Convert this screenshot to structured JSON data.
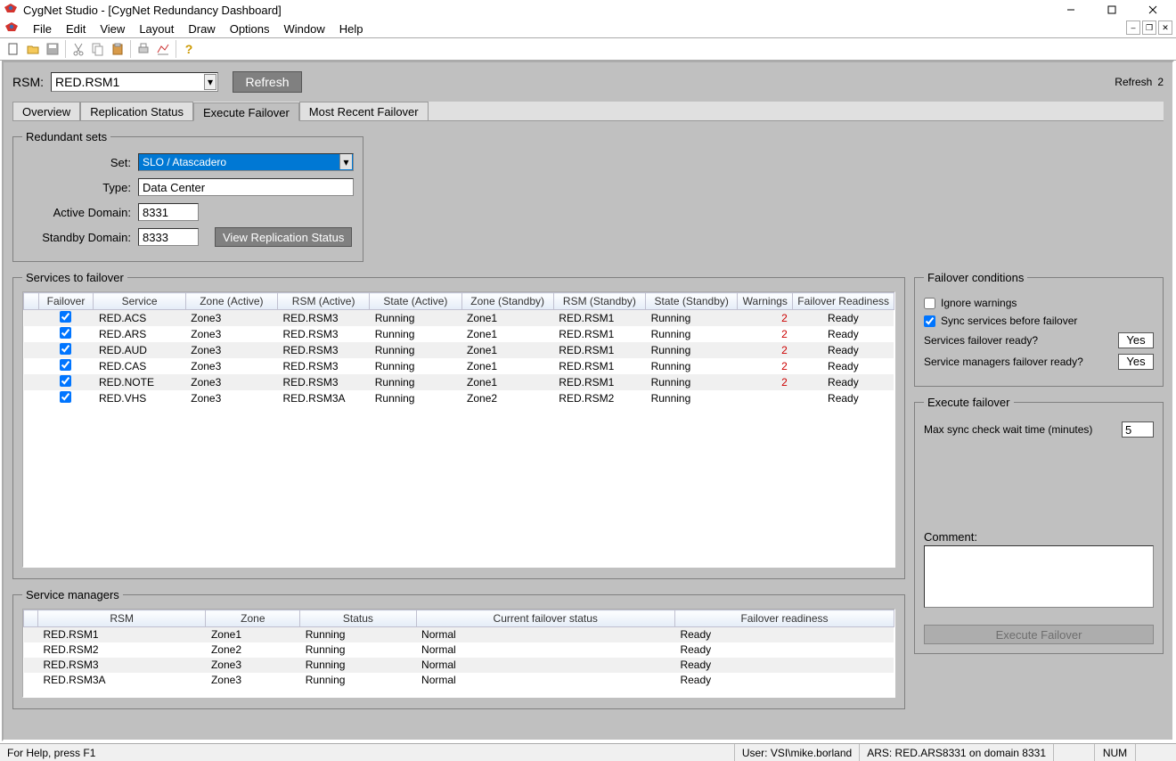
{
  "window_title": "CygNet Studio - [CygNet Redundancy Dashboard]",
  "menu": [
    "File",
    "Edit",
    "View",
    "Layout",
    "Draw",
    "Options",
    "Window",
    "Help"
  ],
  "rsm_label": "RSM:",
  "rsm_value": "RED.RSM1",
  "refresh_btn": "Refresh",
  "refresh_lbl": "Refresh",
  "refresh_count": "2",
  "tabs": [
    "Overview",
    "Replication Status",
    "Execute Failover",
    "Most Recent Failover"
  ],
  "active_tab": 2,
  "redundant_sets": {
    "legend": "Redundant sets",
    "set_label": "Set:",
    "set_value": "SLO / Atascadero",
    "type_label": "Type:",
    "type_value": "Data Center",
    "active_domain_label": "Active Domain:",
    "active_domain_value": "8331",
    "standby_domain_label": "Standby Domain:",
    "standby_domain_value": "8333",
    "view_repl_btn": "View Replication Status"
  },
  "services_legend": "Services to failover",
  "services_cols": [
    "Failover",
    "Service",
    "Zone (Active)",
    "RSM (Active)",
    "State (Active)",
    "Zone (Standby)",
    "RSM (Standby)",
    "State (Standby)",
    "Warnings",
    "Failover Readiness"
  ],
  "services_rows": [
    {
      "chk": true,
      "svc": "RED.ACS",
      "za": "Zone3",
      "ra": "RED.RSM3",
      "sa": "Running",
      "zs": "Zone1",
      "rs": "RED.RSM1",
      "ss": "Running",
      "w": "2",
      "fr": "Ready"
    },
    {
      "chk": true,
      "svc": "RED.ARS",
      "za": "Zone3",
      "ra": "RED.RSM3",
      "sa": "Running",
      "zs": "Zone1",
      "rs": "RED.RSM1",
      "ss": "Running",
      "w": "2",
      "fr": "Ready"
    },
    {
      "chk": true,
      "svc": "RED.AUD",
      "za": "Zone3",
      "ra": "RED.RSM3",
      "sa": "Running",
      "zs": "Zone1",
      "rs": "RED.RSM1",
      "ss": "Running",
      "w": "2",
      "fr": "Ready"
    },
    {
      "chk": true,
      "svc": "RED.CAS",
      "za": "Zone3",
      "ra": "RED.RSM3",
      "sa": "Running",
      "zs": "Zone1",
      "rs": "RED.RSM1",
      "ss": "Running",
      "w": "2",
      "fr": "Ready"
    },
    {
      "chk": true,
      "svc": "RED.NOTE",
      "za": "Zone3",
      "ra": "RED.RSM3",
      "sa": "Running",
      "zs": "Zone1",
      "rs": "RED.RSM1",
      "ss": "Running",
      "w": "2",
      "fr": "Ready"
    },
    {
      "chk": true,
      "svc": "RED.VHS",
      "za": "Zone3",
      "ra": "RED.RSM3A",
      "sa": "Running",
      "zs": "Zone2",
      "rs": "RED.RSM2",
      "ss": "Running",
      "w": "",
      "fr": "Ready"
    }
  ],
  "managers_legend": "Service managers",
  "managers_cols": [
    "RSM",
    "Zone",
    "Status",
    "Current failover status",
    "Failover readiness"
  ],
  "managers_rows": [
    {
      "rsm": "RED.RSM1",
      "zone": "Zone1",
      "status": "Running",
      "cfs": "Normal",
      "fr": "Ready"
    },
    {
      "rsm": "RED.RSM2",
      "zone": "Zone2",
      "status": "Running",
      "cfs": "Normal",
      "fr": "Ready"
    },
    {
      "rsm": "RED.RSM3",
      "zone": "Zone3",
      "status": "Running",
      "cfs": "Normal",
      "fr": "Ready"
    },
    {
      "rsm": "RED.RSM3A",
      "zone": "Zone3",
      "status": "Running",
      "cfs": "Normal",
      "fr": "Ready"
    }
  ],
  "conditions": {
    "legend": "Failover conditions",
    "ignore_warnings": "Ignore warnings",
    "sync_before": "Sync services before failover",
    "svc_ready": "Services failover ready?",
    "mgr_ready": "Service managers failover ready?",
    "yes": "Yes"
  },
  "execute": {
    "legend": "Execute failover",
    "max_sync": "Max sync check wait time (minutes)",
    "max_sync_val": "5",
    "comment_label": "Comment:",
    "btn": "Execute Failover"
  },
  "statusbar": {
    "help": "For Help, press F1",
    "user": "User: VSI\\mike.borland",
    "ars": "ARS: RED.ARS8331 on domain 8331",
    "num": "NUM"
  }
}
